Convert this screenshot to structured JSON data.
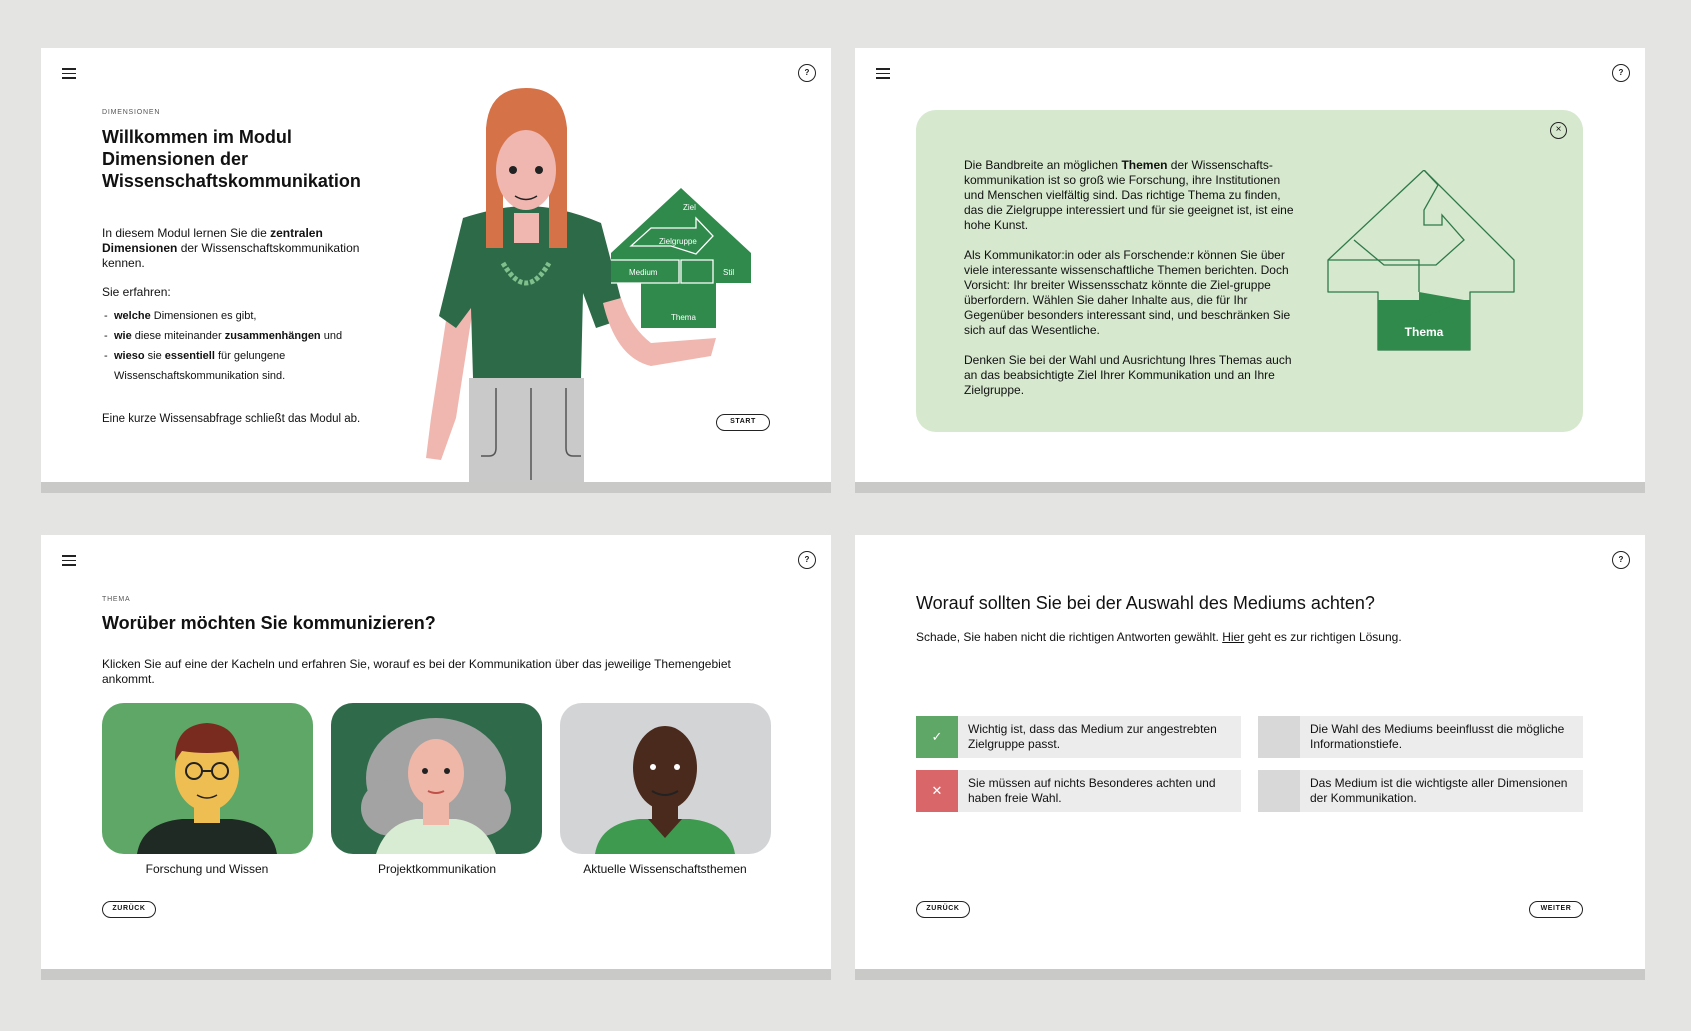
{
  "colors": {
    "background": "#e4e4e2",
    "accent_green": "#2f6b4a",
    "light_green": "#5ea766",
    "card_green": "#d6e8ce",
    "wrong_red": "#d9676a"
  },
  "slide1": {
    "eyebrow": "DIMENSIONEN",
    "title_line1": "Willkommen im Modul",
    "title_line2": "Dimensionen der",
    "title_line3": "Wissenschaftskommunikation",
    "intro_prefix": "In diesem Modul lernen Sie die ",
    "intro_bold": "zentralen Dimensionen",
    "intro_suffix": " der Wissenschaftskommunikation kennen.",
    "sie_erfahren": "Sie erfahren:",
    "bullet1_bold": "welche",
    "bullet1_rest": " Dimensionen es gibt,",
    "bullet2_bold1": "wie",
    "bullet2_mid": " diese miteinander ",
    "bullet2_bold2": "zusammenhängen",
    "bullet2_rest": " und",
    "bullet3_bold1": "wieso",
    "bullet3_mid": " sie ",
    "bullet3_bold2": "essentiell",
    "bullet3_rest": " für gelungene Wissenschaftskommunikation sind.",
    "outro": "Eine kurze Wissensabfrage schließt das Modul ab.",
    "start_button": "START",
    "diagram_labels": {
      "ziel": "Ziel",
      "zielgruppe": "Zielgruppe",
      "medium": "Medium",
      "stil": "Stil",
      "thema": "Thema"
    }
  },
  "slide2": {
    "p1_prefix": "Die Bandbreite an möglichen ",
    "p1_bold": "Themen",
    "p1_rest": " der Wissenschafts-kommunikation ist so groß wie Forschung, ihre Institutionen und Menschen vielfältig sind. Das richtige Thema zu finden, das die Zielgruppe interessiert und für sie geeignet ist, ist eine hohe Kunst.",
    "p2": "Als Kommunikator:in oder als Forschende:r können Sie über viele interessante wissenschaftliche Themen berichten. Doch Vorsicht: Ihr breiter Wissensschatz könnte die Ziel-gruppe überfordern. Wählen Sie daher Inhalte aus, die für Ihr Gegenüber besonders interessant sind, und beschränken Sie sich auf das Wesentliche.",
    "p3": "Denken Sie bei der Wahl und Ausrichtung Ihres Themas auch an das beabsichtigte Ziel Ihrer Kommunikation und an Ihre Zielgruppe.",
    "diagram_label": "Thema"
  },
  "slide3": {
    "eyebrow": "THEMA",
    "title": "Worüber möchten Sie kommunizieren?",
    "intro": "Klicken Sie auf eine der Kacheln und erfahren Sie, worauf es bei der Kommunikation über das jeweilige Themengebiet ankommt.",
    "tiles": [
      {
        "label": "Forschung und Wissen"
      },
      {
        "label": "Projektkommunikation"
      },
      {
        "label": "Aktuelle Wissenschaftsthemen"
      }
    ],
    "back_button": "ZURÜCK"
  },
  "slide4": {
    "question": "Worauf sollten Sie bei der Auswahl des Mediums achten?",
    "feedback_prefix": "Schade, Sie haben nicht die richtigen Antworten gewählt. ",
    "feedback_link": "Hier",
    "feedback_suffix": " geht es zur richtigen Lösung.",
    "answers": [
      {
        "text": "Wichtig ist, dass das Medium zur angestrebten Zielgruppe passt.",
        "state": "correct"
      },
      {
        "text": "Die Wahl des Mediums beeinflusst die mögliche Informationstiefe.",
        "state": "neutral"
      },
      {
        "text": "Sie müssen auf nichts Besonderes achten und haben freie Wahl.",
        "state": "wrong"
      },
      {
        "text": "Das Medium ist die wichtigste aller Dimensionen der Kommunikation.",
        "state": "neutral"
      }
    ],
    "back_button": "ZURÜCK",
    "next_button": "WEITER"
  }
}
